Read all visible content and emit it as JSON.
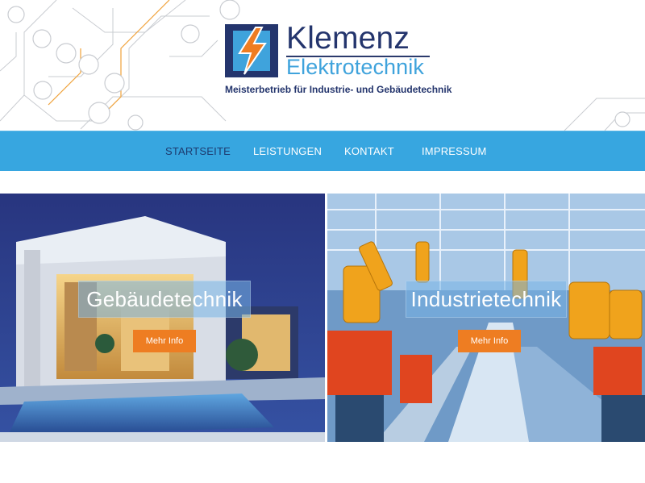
{
  "brand": {
    "name": "Klemenz",
    "subtitle": "Elektrotechnik",
    "tagline": "Meisterbetrieb für Industrie- und Gebäudetechnik",
    "colors": {
      "navy": "#24356d",
      "blue": "#3fa3dc",
      "orange": "#ee7d22"
    }
  },
  "nav": {
    "items": [
      {
        "label": "STARTSEITE",
        "active": true
      },
      {
        "label": "LEISTUNGEN",
        "active": false
      },
      {
        "label": "KONTAKT",
        "active": false
      },
      {
        "label": "IMPRESSUM",
        "active": false
      }
    ],
    "background": "#37a6e0"
  },
  "panels": [
    {
      "title": "Gebäudetechnik",
      "button": "Mehr Info",
      "image": "modern-house-photo"
    },
    {
      "title": "Industrietechnik",
      "button": "Mehr Info",
      "image": "industrial-robots-photo"
    }
  ]
}
